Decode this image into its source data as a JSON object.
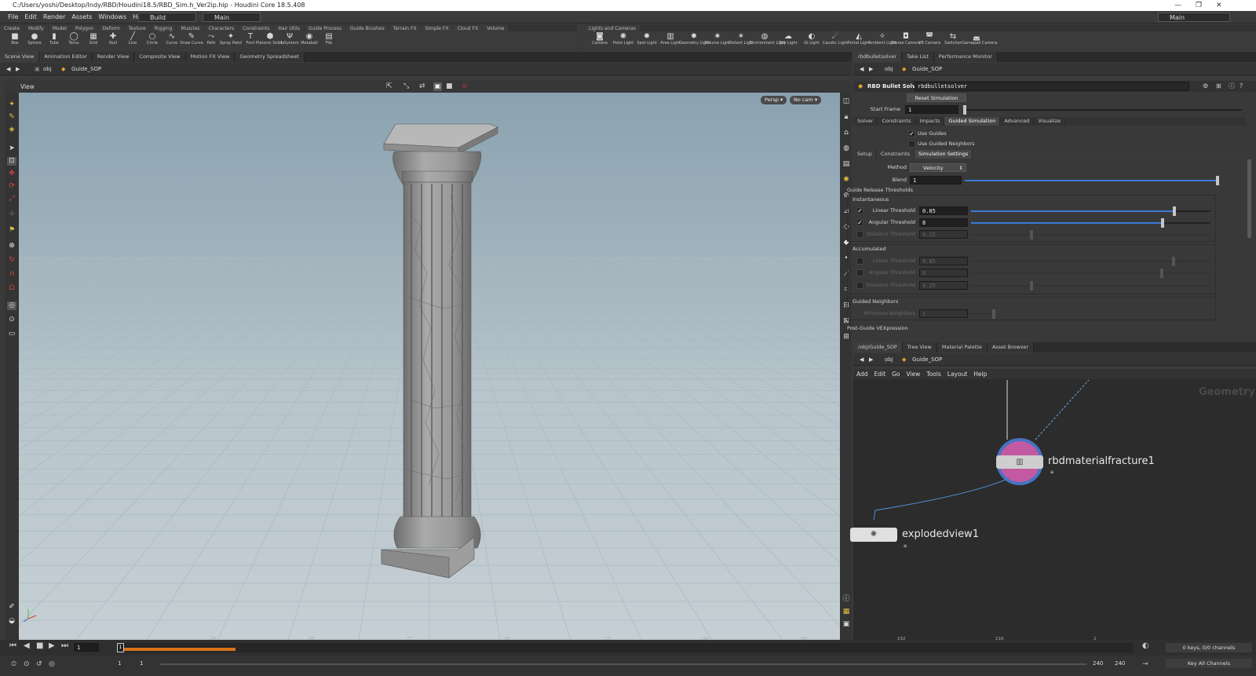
{
  "titlebar": {
    "title": "C:/Users/yoshi/Desktop/Indy/RBD/Houdini18.5/RBD_Sim.h_Ver2ip.hip - Houdini Core 18.5.408"
  },
  "menubar": {
    "items": [
      "File",
      "Edit",
      "Render",
      "Assets",
      "Windows",
      "Help"
    ],
    "desktop_build": "Build",
    "desktop_main": "Main",
    "right_main": "Main"
  },
  "shelf_left": {
    "tabs": [
      "Create",
      "Modify",
      "Model",
      "Polygon",
      "Deform",
      "Texture",
      "Rigging",
      "Muscles",
      "Characters",
      "Constraints",
      "Hair Utils",
      "Guide Process",
      "Guide Brushes",
      "Terrain FX",
      "Simple FX",
      "Cloud FX",
      "Volume"
    ],
    "tools": [
      {
        "label": "Box",
        "icon": "■"
      },
      {
        "label": "Sphere",
        "icon": "●"
      },
      {
        "label": "Tube",
        "icon": "▮"
      },
      {
        "label": "Torus",
        "icon": "◯"
      },
      {
        "label": "Grid",
        "icon": "▦"
      },
      {
        "label": "Null",
        "icon": "✚"
      },
      {
        "label": "Line",
        "icon": "╱"
      },
      {
        "label": "Circle",
        "icon": "○"
      },
      {
        "label": "Curve",
        "icon": "∿"
      },
      {
        "label": "Draw Curve",
        "icon": "✎"
      },
      {
        "label": "Path",
        "icon": "⤳"
      },
      {
        "label": "Spray Paint",
        "icon": "✦"
      },
      {
        "label": "Font",
        "icon": "T"
      },
      {
        "label": "Platonic Solids",
        "icon": "⬢"
      },
      {
        "label": "L-System",
        "icon": "Ψ"
      },
      {
        "label": "Metaball",
        "icon": "◉"
      },
      {
        "label": "File",
        "icon": "▤"
      }
    ]
  },
  "shelf_right": {
    "tabs": [
      "Lights and Cameras"
    ],
    "tools": [
      {
        "label": "Camera",
        "icon": "◙"
      },
      {
        "label": "Point Light",
        "icon": "✺"
      },
      {
        "label": "Spot Light",
        "icon": "✹"
      },
      {
        "label": "Area Light",
        "icon": "▥"
      },
      {
        "label": "Geometry Light",
        "icon": "✸"
      },
      {
        "label": "Volume Light",
        "icon": "✷"
      },
      {
        "label": "Distant Light",
        "icon": "✶"
      },
      {
        "label": "Environment Light",
        "icon": "◍"
      },
      {
        "label": "Sky Light",
        "icon": "☁"
      },
      {
        "label": "GI Light",
        "icon": "◐"
      },
      {
        "label": "Caustic Light",
        "icon": "☄"
      },
      {
        "label": "Portal Light",
        "icon": "◭"
      },
      {
        "label": "Ambient Light",
        "icon": "✧"
      },
      {
        "label": "Stereo Camera",
        "icon": "◘"
      },
      {
        "label": "VR Camera",
        "icon": "◚"
      },
      {
        "label": "Switcher",
        "icon": "⇆"
      },
      {
        "label": "Gamepad Camera",
        "icon": "◛"
      }
    ]
  },
  "left_panetabs": [
    "Scene View",
    "Animation Editor",
    "Render View",
    "Composite View",
    "Motion FX View",
    "Geometry Spreadsheet"
  ],
  "right_panetabs": [
    "rbdbulletsolver",
    "Take List",
    "Performance Monitor"
  ],
  "left_path": {
    "root": "obj",
    "node": "Guide_SOP"
  },
  "viewport": {
    "title": "View",
    "persp": "Persp",
    "cam": "No cam"
  },
  "params": {
    "path_root": "obj",
    "path_node": "Guide_SOP",
    "node_type": "RBD Bullet Solver",
    "node_name": "rbdbulletsolver",
    "reset_button": "Reset Simulation",
    "start_frame_label": "Start Frame",
    "start_frame_value": "1",
    "tabs": [
      "Solver",
      "Constraints",
      "Impacts",
      "Guided Simulation",
      "Advanced",
      "Visualize"
    ],
    "use_guides": "Use Guides",
    "use_guided_neighbors": "Use Guided Neighbors",
    "subtabs": [
      "Setup",
      "Constraints",
      "Simulation Settings"
    ],
    "method_label": "Method",
    "method_value": "Velocity",
    "blend_label": "Blend",
    "blend_value": "1",
    "blend_level": 1.0,
    "release_heading": "Guide Release Thresholds",
    "instantaneous": "Instantaneous",
    "linear_label": "Linear Threshold",
    "linear_value": "0.85",
    "linear_level": 0.85,
    "angular_label": "Angular Threshold",
    "angular_value": "8",
    "angular_level": 0.8,
    "distance_label": "Distance Threshold",
    "distance_value": "0.25",
    "accumulated": "Accumulated",
    "acc_linear_label": "Linear Threshold",
    "acc_linear_value": "0.85",
    "acc_angular_label": "Angular Threshold",
    "acc_angular_value": "8",
    "acc_distance_label": "Distance Threshold",
    "acc_distance_value": "0.25",
    "guided_neighbors": "Guided Neighbors",
    "min_neighbors_label": "Minimum Neighbors",
    "min_neighbors_value": "1",
    "post_guide": "Post-Guide VEXpression"
  },
  "network_panetabs": [
    "/obj/Guide_SOP",
    "Tree View",
    "Material Palette",
    "Asset Browser"
  ],
  "network": {
    "path_root": "obj",
    "path_node": "Guide_SOP",
    "menu": [
      "Add",
      "Edit",
      "Go",
      "View",
      "Tools",
      "Layout",
      "Help"
    ],
    "context_label": "Geometry",
    "nodes": [
      {
        "name": "rbdmaterialfracture1"
      },
      {
        "name": "explodedview1"
      }
    ]
  },
  "timeline": {
    "current_frame": "1",
    "ticks": [
      "24",
      "48",
      "72",
      "96",
      "120",
      "144",
      "168",
      "192",
      "216",
      "2"
    ],
    "playbar_start_a": "1",
    "playbar_start_b": "1",
    "playbar_end_a": "240",
    "playbar_end_b": "240",
    "channels": "0 keys, 0/0 channels",
    "key_all": "Key All Channels"
  },
  "colors": {
    "accent": "#3d7bd6",
    "timeline_orange": "#d9741a",
    "node_ring": "#4b7bd4",
    "node_pink": "#d45fae"
  }
}
